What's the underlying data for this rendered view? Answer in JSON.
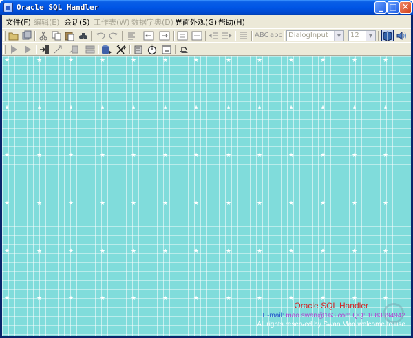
{
  "window": {
    "title": "Oracle SQL Handler",
    "minimize": "_",
    "maximize": "□",
    "close": "✕"
  },
  "menu": [
    {
      "label": "文件(F)",
      "enabled": true
    },
    {
      "label": "编辑(E)",
      "enabled": false
    },
    {
      "label": "会话(S)",
      "enabled": true
    },
    {
      "label": "工作表(W)",
      "enabled": false
    },
    {
      "label": "数据字典(D)",
      "enabled": false
    },
    {
      "label": "界面外观(G)",
      "enabled": true
    },
    {
      "label": "帮助(H)",
      "enabled": true
    }
  ],
  "toolbar": {
    "text_abc_upper": "ABC",
    "text_abc_lower": "abc",
    "font_combo": "DialogInput",
    "size_combo": "12"
  },
  "about": {
    "product": "Oracle SQL Handler",
    "email_label": "E-mail: ",
    "email_value": "mao.swan@163.com   QQ: 1083394942",
    "rights": "All rights reserved by Swan Mao,welcome to use"
  },
  "colors": {
    "desktop": "#80dcdb",
    "about_title": "#d02828",
    "about_email": "#2050c8"
  }
}
